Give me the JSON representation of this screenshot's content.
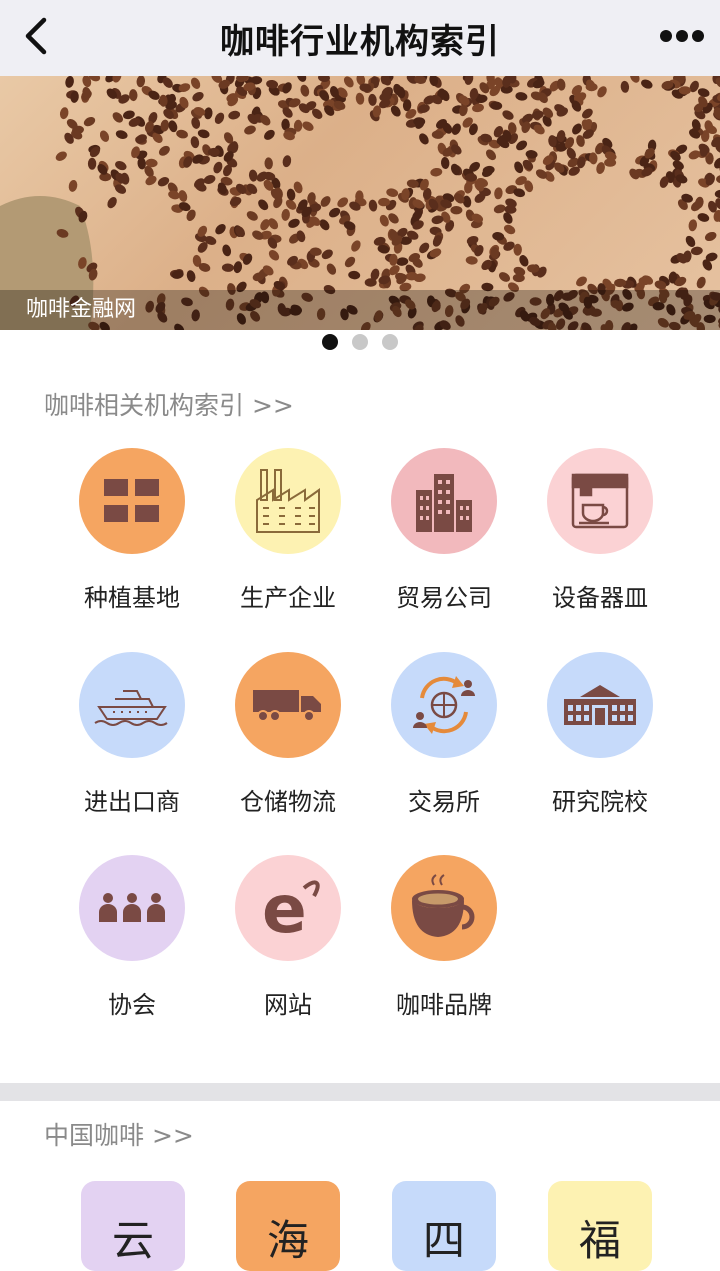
{
  "header": {
    "title": "咖啡行业机构索引",
    "back_icon": "chevron-left-icon",
    "more_icon": "ellipsis-icon"
  },
  "banner": {
    "caption": "咖啡金融网",
    "slides": 3,
    "active_slide": 1
  },
  "section1": {
    "title": "咖啡相关机构索引 >>",
    "items": [
      {
        "label": "种植基地",
        "icon": "grid-blocks-icon",
        "bg": "#f5a561"
      },
      {
        "label": "生产企业",
        "icon": "factory-icon",
        "bg": "#fdf2b2"
      },
      {
        "label": "贸易公司",
        "icon": "buildings-icon",
        "bg": "#f2b9bd"
      },
      {
        "label": "设备器皿",
        "icon": "coffee-machine-icon",
        "bg": "#fbd2d4"
      },
      {
        "label": "进出口商",
        "icon": "ship-icon",
        "bg": "#c6dafa"
      },
      {
        "label": "仓储物流",
        "icon": "truck-icon",
        "bg": "#f5a561"
      },
      {
        "label": "交易所",
        "icon": "exchange-icon",
        "bg": "#c6dafa"
      },
      {
        "label": "研究院校",
        "icon": "school-icon",
        "bg": "#c6dafa"
      },
      {
        "label": "协会",
        "icon": "people-icon",
        "bg": "#e3d2f2"
      },
      {
        "label": "网站",
        "icon": "browser-e-icon",
        "bg": "#fbd2d4"
      },
      {
        "label": "咖啡品牌",
        "icon": "coffee-cup-icon",
        "bg": "#f5a561"
      }
    ]
  },
  "section2": {
    "title": "中国咖啡 >>",
    "tiles": [
      {
        "label": "云",
        "bg": "#e3d2f2"
      },
      {
        "label": "海",
        "bg": "#f5a561"
      },
      {
        "label": "四",
        "bg": "#c6dafa"
      },
      {
        "label": "福",
        "bg": "#fdf2b2"
      }
    ]
  },
  "colors": {
    "icon": "#7a4a44",
    "header_bg": "#efeff4",
    "divider": "#e3e3e6"
  }
}
